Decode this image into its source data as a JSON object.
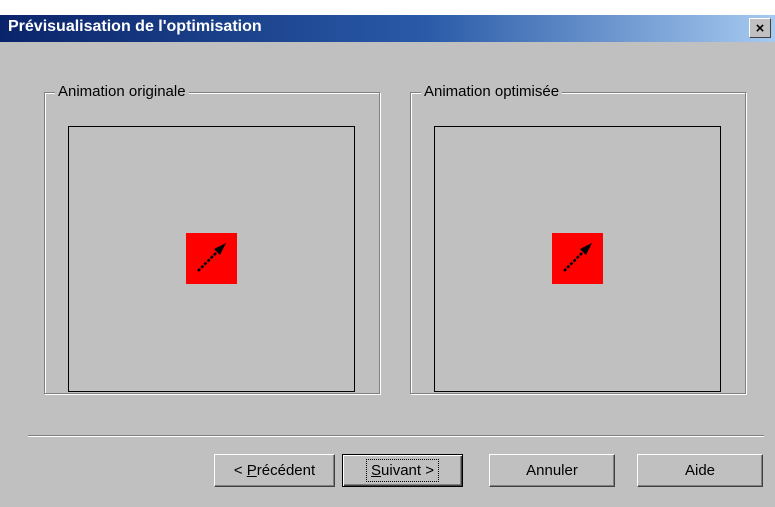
{
  "window": {
    "title": "Prévisualisation de l'optimisation",
    "close_glyph": "×",
    "colors": {
      "face": "#c0c0c0",
      "title_start": "#0a246a",
      "title_end": "#a6caf0",
      "sprite": "#ff0000"
    }
  },
  "groups": {
    "original": {
      "label": "Animation originale",
      "sprite_icon": "arrow-cursor-icon"
    },
    "optimized": {
      "label": "Animation optimisée",
      "sprite_icon": "arrow-cursor-icon"
    }
  },
  "buttons": {
    "previous": {
      "prefix": "< ",
      "mnemonic": "P",
      "rest": "récédent"
    },
    "next": {
      "mnemonic": "S",
      "rest": "uivant",
      "suffix": " >"
    },
    "cancel": "Annuler",
    "help": "Aide"
  }
}
